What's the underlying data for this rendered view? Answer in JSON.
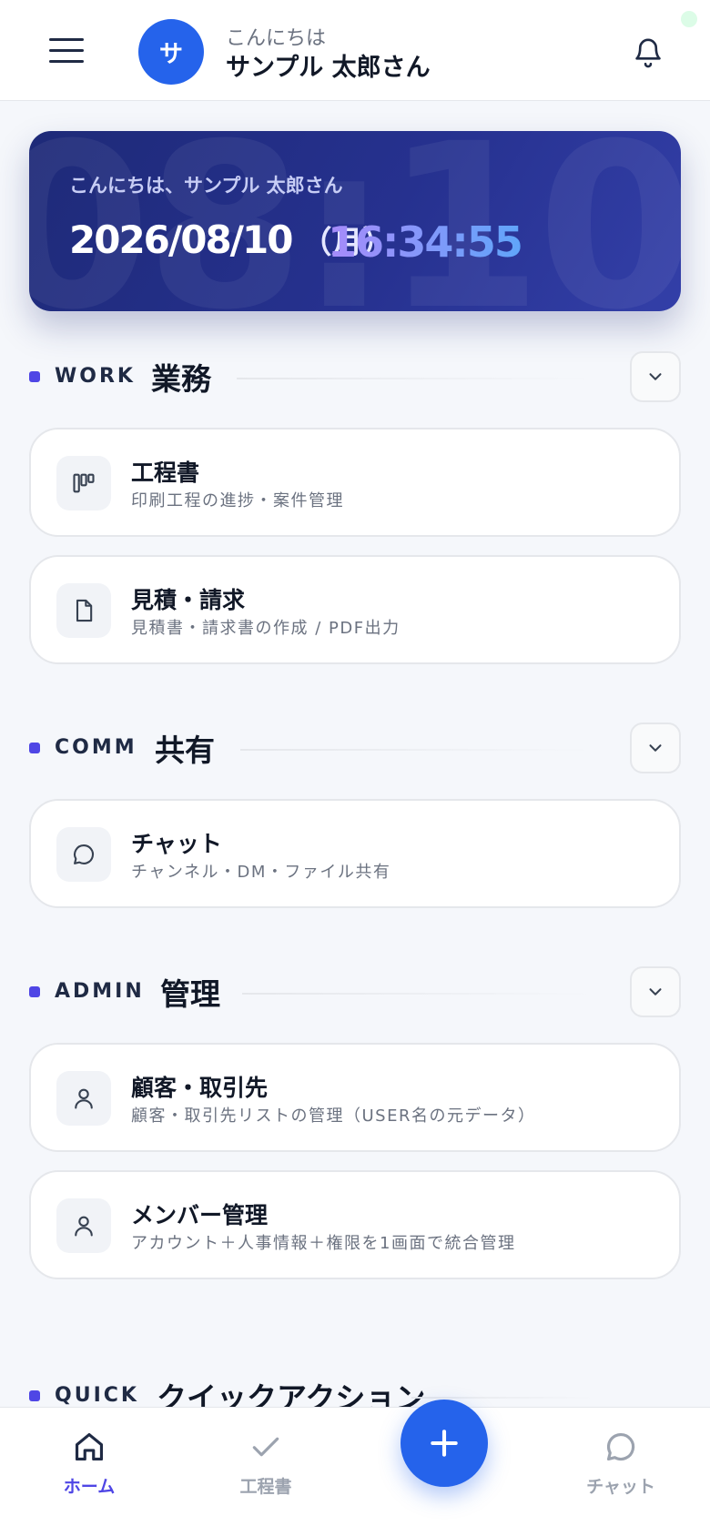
{
  "header": {
    "avatar_initial": "サ",
    "greeting_small": "こんにちは",
    "user_name": "サンプル 太郎さん"
  },
  "hero": {
    "greeting": "こんにちは、サンプル 太郎さん",
    "date": "2026/08/10",
    "weekday": "（月）",
    "time": "16:34:55",
    "background_time": "08:10"
  },
  "sections": {
    "work": {
      "en": "WORK",
      "jp": "業務",
      "items": [
        {
          "title": "工程書",
          "subtitle": "印刷工程の進捗・案件管理",
          "icon": "kanban-icon"
        },
        {
          "title": "見積・請求",
          "subtitle": "見積書・請求書の作成 / PDF出力",
          "icon": "document-icon"
        }
      ]
    },
    "comm": {
      "en": "COMM",
      "jp": "共有",
      "items": [
        {
          "title": "チャット",
          "subtitle": "チャンネル・DM・ファイル共有",
          "icon": "chat-icon"
        }
      ]
    },
    "admin": {
      "en": "ADMIN",
      "jp": "管理",
      "items": [
        {
          "title": "顧客・取引先",
          "subtitle": "顧客・取引先リストの管理（USER名の元データ）",
          "icon": "person-icon"
        },
        {
          "title": "メンバー管理",
          "subtitle": "アカウント＋人事情報＋権限を1画面で統合管理",
          "icon": "person-icon"
        }
      ]
    },
    "quick": {
      "en": "QUICK",
      "jp": "クイックアクション"
    }
  },
  "bottom_nav": {
    "home": "ホーム",
    "process": "工程書",
    "chat": "チャット"
  },
  "colors": {
    "primary": "#2563eb",
    "accent": "#4f46e5",
    "hero_dark": "#1e2a78"
  }
}
